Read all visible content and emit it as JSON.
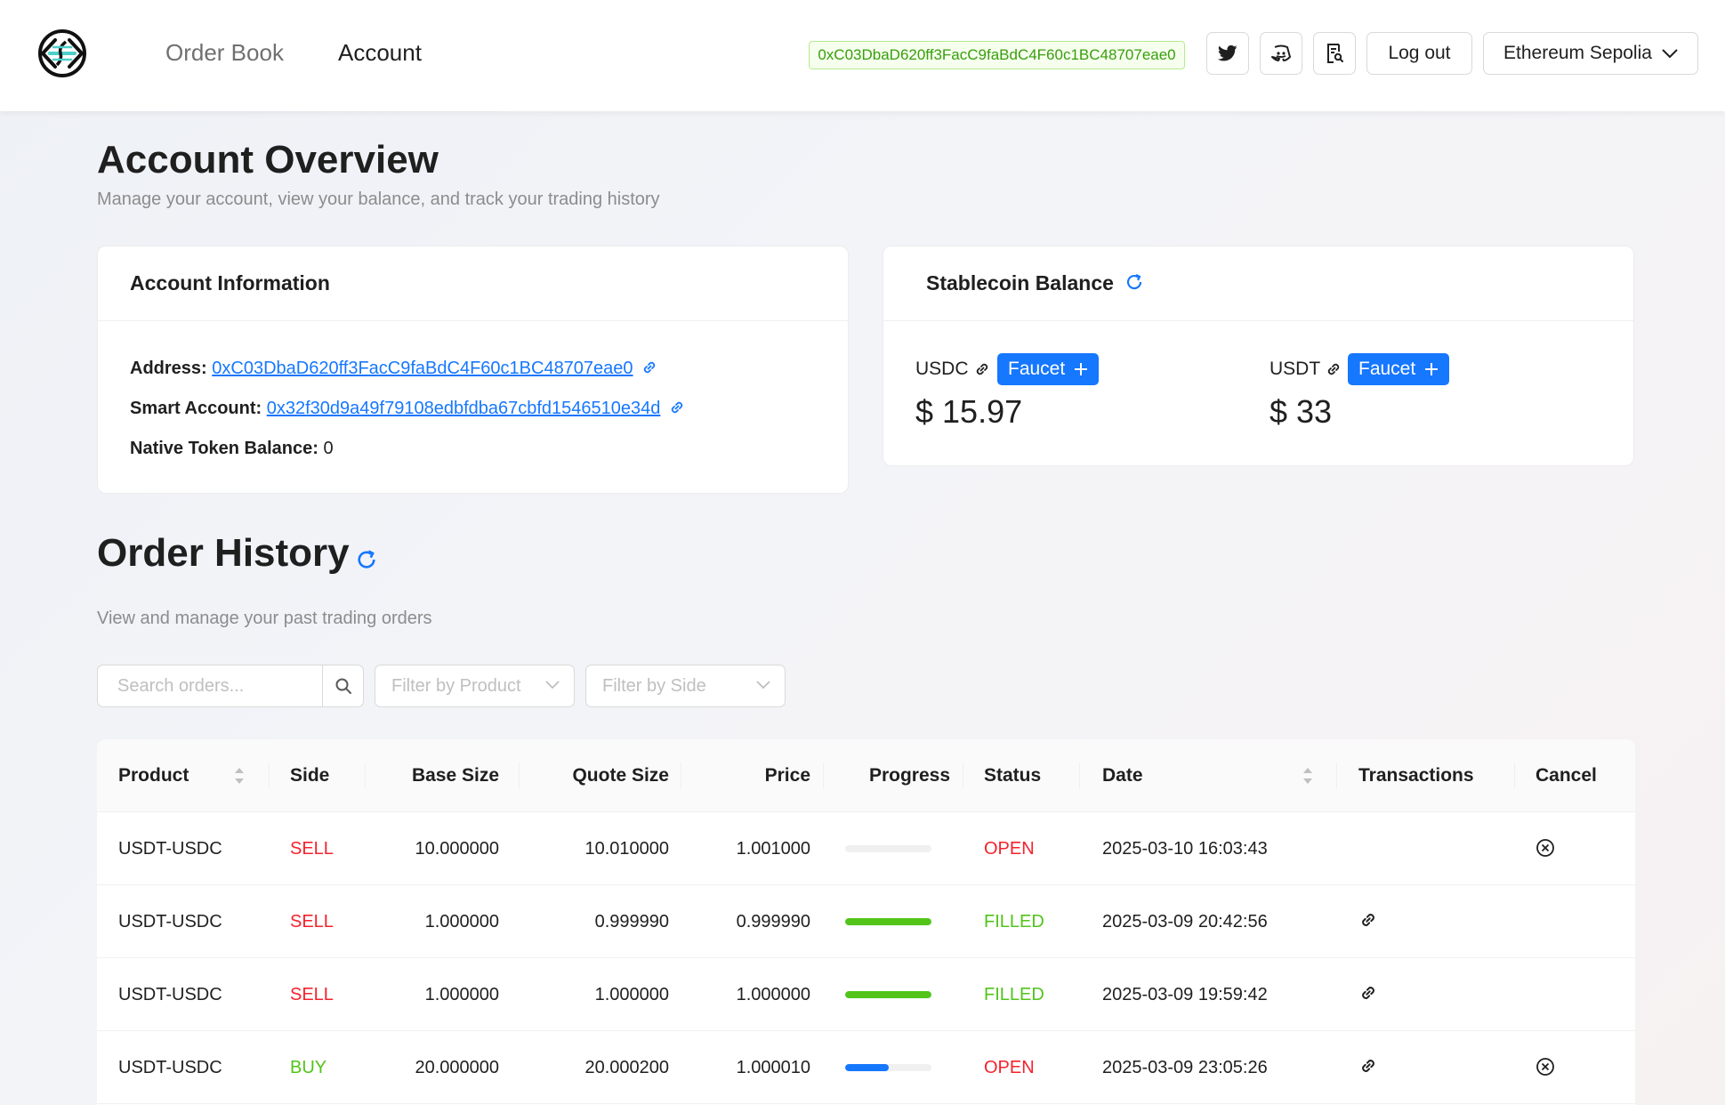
{
  "header": {
    "nav": [
      {
        "label": "Order Book",
        "active": false
      },
      {
        "label": "Account",
        "active": true
      }
    ],
    "wallet_address": "0xC03DbaD620ff3FacC9faBdC4F60c1BC48707eae0",
    "icons": [
      "twitter-icon",
      "discord-icon",
      "docs-icon"
    ],
    "logout_label": "Log out",
    "network_label": "Ethereum Sepolia"
  },
  "overview": {
    "title": "Account Overview",
    "subtitle": "Manage your account, view your balance, and track your trading history"
  },
  "account_info": {
    "title": "Account Information",
    "address_label": "Address:",
    "address_value": "0xC03DbaD620ff3FacC9faBdC4F60c1BC48707eae0",
    "smart_account_label": "Smart Account:",
    "smart_account_value": "0x32f30d9a49f79108edbfdba67cbfd1546510e34d",
    "native_balance_label": "Native Token Balance:",
    "native_balance_value": "0"
  },
  "stablecoin": {
    "title": "Stablecoin Balance",
    "coins": [
      {
        "symbol": "USDC",
        "faucet_label": "Faucet",
        "balance": "$ 15.97"
      },
      {
        "symbol": "USDT",
        "faucet_label": "Faucet",
        "balance": "$ 33"
      }
    ]
  },
  "order_history": {
    "title": "Order History",
    "subtitle": "View and manage your past trading orders",
    "search_placeholder": "Search orders...",
    "filter_product_placeholder": "Filter by Product",
    "filter_side_placeholder": "Filter by Side",
    "columns": [
      "Product",
      "Side",
      "Base Size",
      "Quote Size",
      "Price",
      "Progress",
      "Status",
      "Date",
      "Transactions",
      "Cancel"
    ],
    "rows": [
      {
        "product": "USDT-USDC",
        "side": "SELL",
        "base_size": "10.000000",
        "quote_size": "10.010000",
        "price": "1.001000",
        "progress": 0,
        "status": "OPEN",
        "date": "2025-03-10 16:03:43",
        "has_tx": false,
        "cancelable": true
      },
      {
        "product": "USDT-USDC",
        "side": "SELL",
        "base_size": "1.000000",
        "quote_size": "0.999990",
        "price": "0.999990",
        "progress": 1.0,
        "status": "FILLED",
        "date": "2025-03-09 20:42:56",
        "has_tx": true,
        "cancelable": false
      },
      {
        "product": "USDT-USDC",
        "side": "SELL",
        "base_size": "1.000000",
        "quote_size": "1.000000",
        "price": "1.000000",
        "progress": 1.0,
        "status": "FILLED",
        "date": "2025-03-09 19:59:42",
        "has_tx": true,
        "cancelable": false
      },
      {
        "product": "USDT-USDC",
        "side": "BUY",
        "base_size": "20.000000",
        "quote_size": "20.000200",
        "price": "1.000010",
        "progress": 0.5,
        "status": "OPEN",
        "date": "2025-03-09 23:05:26",
        "has_tx": true,
        "cancelable": true
      }
    ]
  },
  "colors": {
    "primary": "#1677ff",
    "sell": "#f5222d",
    "buy": "#52c41a",
    "progress_filled": "#52c41a",
    "progress_partial": "#1677ff",
    "address_tag_text": "#389e0d",
    "address_tag_bg": "#f6ffed"
  }
}
